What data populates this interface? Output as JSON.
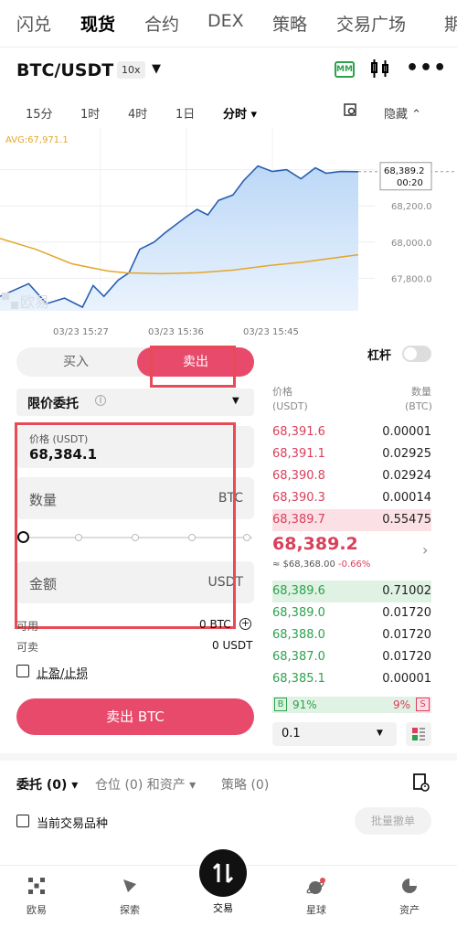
{
  "nav": {
    "tabs": [
      "闪兑",
      "现货",
      "合约",
      "DEX",
      "策略",
      "交易广场",
      "期"
    ],
    "active": 1
  },
  "pair": {
    "name": "BTC/USDT",
    "leverage": "10x"
  },
  "timeframes": {
    "items": [
      "15分",
      "1时",
      "4时",
      "1日",
      "分时"
    ],
    "hide": "隐藏"
  },
  "chart_data": {
    "type": "area",
    "avg_label": "AVG:67,971.1",
    "watermark": "欧易",
    "price_tag": "68,389.2",
    "countdown": "00:20",
    "y_ticks": [
      "68,400.0",
      "68,200.0",
      "68,000.0",
      "67,800.0"
    ],
    "x_ticks": [
      "03/23 15:27",
      "03/23 15:36",
      "03/23 15:45"
    ],
    "ylim": [
      67620,
      68610
    ],
    "x_range": [
      0,
      100
    ],
    "price": {
      "x": [
        0,
        8,
        13,
        18,
        23,
        26,
        29,
        33,
        36,
        39,
        43,
        46,
        48,
        52,
        55,
        58,
        61,
        65,
        68,
        72,
        76,
        80,
        84,
        88,
        91,
        95,
        100
      ],
      "y": [
        67700,
        67770,
        67660,
        67690,
        67640,
        67760,
        67700,
        67790,
        67830,
        67960,
        68000,
        68050,
        68080,
        68140,
        68180,
        68150,
        68230,
        68260,
        68340,
        68420,
        68390,
        68400,
        68350,
        68410,
        68380,
        68390,
        68389
      ]
    },
    "avg": {
      "x": [
        0,
        10,
        20,
        30,
        35,
        45,
        55,
        65,
        75,
        85,
        100
      ],
      "y": [
        68020,
        67960,
        67880,
        67840,
        67830,
        67825,
        67830,
        67845,
        67870,
        67890,
        67930
      ]
    }
  },
  "side": {
    "buy": "买入",
    "sell": "卖出",
    "leverage_label": "杠杆"
  },
  "order_type": "限价委托",
  "fields": {
    "price_label": "价格 (USDT)",
    "price_value": "68,384.1",
    "qty_placeholder": "数量",
    "qty_unit": "BTC",
    "amount_placeholder": "金额",
    "amount_unit": "USDT"
  },
  "available": {
    "label": "可用",
    "value": "0 BTC",
    "sell_label": "可卖",
    "sell_value": "0 USDT"
  },
  "tpsl": "止盈/止损",
  "sell_button": "卖出 BTC",
  "orderbook": {
    "h_price": "价格",
    "h_price_unit": "(USDT)",
    "h_qty": "数量",
    "h_qty_unit": "(BTC)",
    "asks": [
      [
        "68,391.6",
        "0.00001"
      ],
      [
        "68,391.1",
        "0.02925"
      ],
      [
        "68,390.8",
        "0.02924"
      ],
      [
        "68,390.3",
        "0.00014"
      ],
      [
        "68,389.7",
        "0.55475"
      ]
    ],
    "last_price": "68,389.2",
    "last_usd": "≈ $68,368.00",
    "last_change": "-0.66%",
    "bids": [
      [
        "68,389.6",
        "0.71002"
      ],
      [
        "68,389.0",
        "0.01720"
      ],
      [
        "68,388.0",
        "0.01720"
      ],
      [
        "68,387.0",
        "0.01720"
      ],
      [
        "68,385.1",
        "0.00001"
      ]
    ],
    "buy_pct_label": "B",
    "buy_pct": "91%",
    "sell_pct": "9%",
    "sell_pct_label": "S",
    "depth": "0.1"
  },
  "orders": {
    "tab1": "委托 (0)",
    "tab2": "仓位 (0) 和资产",
    "tab3": "策略 (0)",
    "current_only": "当前交易品种",
    "batch_cancel": "批量撤单"
  },
  "bottomnav": {
    "items": [
      "欧易",
      "探索",
      "交易",
      "星球",
      "资产"
    ]
  },
  "colors": {
    "sell": "#e84a6b",
    "buy": "#2ca24d",
    "area": "#bcd8f7",
    "line": "#2a5fb0",
    "avg": "#e5a52a"
  }
}
